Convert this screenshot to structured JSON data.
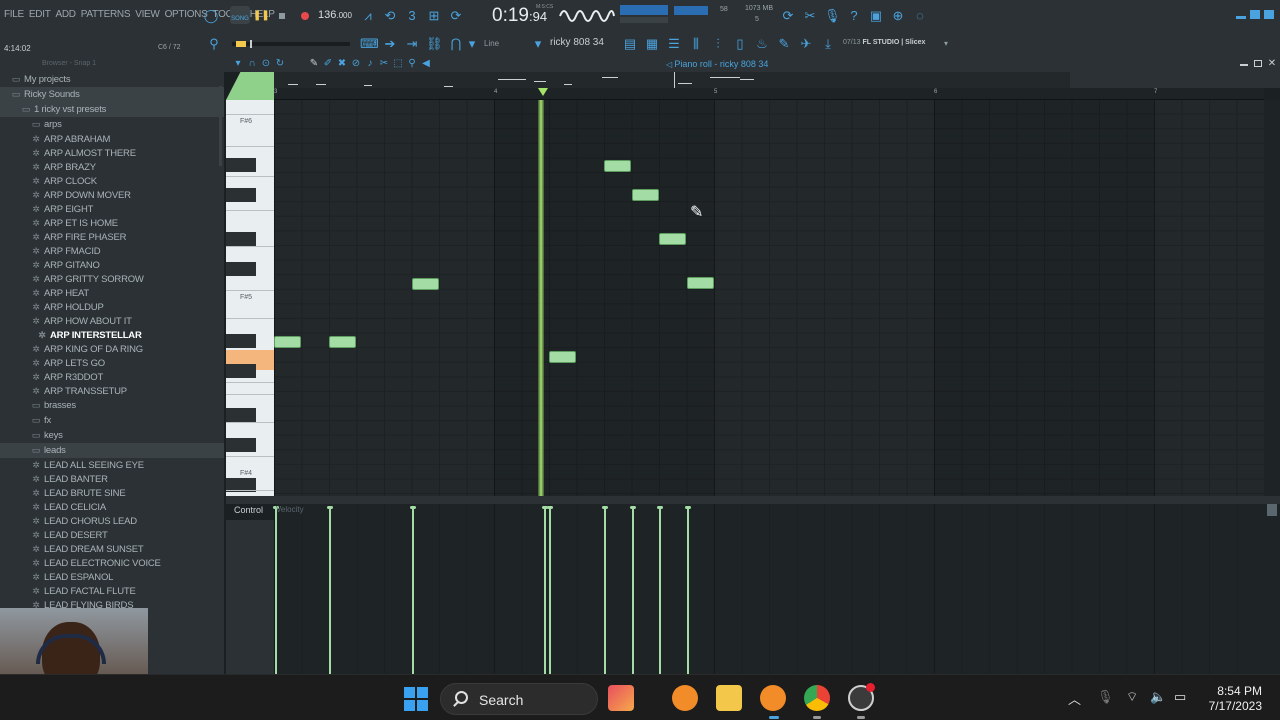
{
  "menu": [
    "FILE",
    "EDIT",
    "ADD",
    "PATTERNS",
    "VIEW",
    "OPTIONS",
    "TOOLS",
    "HELP"
  ],
  "transport": {
    "mode": "SONG",
    "tempo": "136",
    "tempo_decimal": ".000",
    "time_main": "0:19",
    "time_frac": ":94",
    "time_unit": "M:S:CS",
    "cpu_value": "58",
    "memory": "1073 MB",
    "polyphony": "5"
  },
  "toolbar2": {
    "song_position": "4:14:02",
    "channel_pos": "C6 / 72",
    "snap": "Line",
    "pattern": "ricky 808 34",
    "hint_counter": "07/13",
    "hint_text": "FL STUDIO | Slicex"
  },
  "browser": {
    "header": "Browser - Snap 1",
    "tree": [
      {
        "label": "My projects",
        "icon": "folder",
        "indent": 10
      },
      {
        "label": "Ricky Sounds",
        "icon": "folder",
        "indent": 10
      },
      {
        "label": "1 ricky vst presets",
        "icon": "folder",
        "indent": 20
      },
      {
        "label": "arps",
        "icon": "folder",
        "indent": 30
      },
      {
        "label": "ARP ABRAHAM",
        "icon": "preset",
        "indent": 30
      },
      {
        "label": "ARP ALMOST THERE",
        "icon": "preset",
        "indent": 30
      },
      {
        "label": "ARP BRAZY",
        "icon": "preset",
        "indent": 30
      },
      {
        "label": "ARP CLOCK",
        "icon": "preset",
        "indent": 30
      },
      {
        "label": "ARP DOWN MOVER",
        "icon": "preset",
        "indent": 30
      },
      {
        "label": "ARP EIGHT",
        "icon": "preset",
        "indent": 30
      },
      {
        "label": "ARP ET IS HOME",
        "icon": "preset",
        "indent": 30
      },
      {
        "label": "ARP FIRE PHASER",
        "icon": "preset",
        "indent": 30
      },
      {
        "label": "ARP FMACID",
        "icon": "preset",
        "indent": 30
      },
      {
        "label": "ARP GITANO",
        "icon": "preset",
        "indent": 30
      },
      {
        "label": "ARP GRITTY SORROW",
        "icon": "preset",
        "indent": 30
      },
      {
        "label": "ARP HEAT",
        "icon": "preset",
        "indent": 30
      },
      {
        "label": "ARP HOLDUP",
        "icon": "preset",
        "indent": 30
      },
      {
        "label": "ARP HOW ABOUT IT",
        "icon": "preset",
        "indent": 30
      },
      {
        "label": "ARP INTERSTELLAR",
        "icon": "preset",
        "indent": 36
      },
      {
        "label": "ARP KING OF DA RING",
        "icon": "preset",
        "indent": 30
      },
      {
        "label": "ARP LETS GO",
        "icon": "preset",
        "indent": 30
      },
      {
        "label": "ARP R3DDOT",
        "icon": "preset",
        "indent": 30
      },
      {
        "label": "ARP TRANSSETUP",
        "icon": "preset",
        "indent": 30
      },
      {
        "label": "brasses",
        "icon": "folder",
        "indent": 30
      },
      {
        "label": "fx",
        "icon": "folder",
        "indent": 30
      },
      {
        "label": "keys",
        "icon": "folder",
        "indent": 30
      },
      {
        "label": "leads",
        "icon": "folder",
        "indent": 30
      },
      {
        "label": "LEAD ALL SEEING EYE",
        "icon": "preset",
        "indent": 30
      },
      {
        "label": "LEAD BANTER",
        "icon": "preset",
        "indent": 30
      },
      {
        "label": "LEAD BRUTE SINE",
        "icon": "preset",
        "indent": 30
      },
      {
        "label": "LEAD CELICIA",
        "icon": "preset",
        "indent": 30
      },
      {
        "label": "LEAD CHORUS LEAD",
        "icon": "preset",
        "indent": 30
      },
      {
        "label": "LEAD DESERT",
        "icon": "preset",
        "indent": 30
      },
      {
        "label": "LEAD DREAM SUNSET",
        "icon": "preset",
        "indent": 30
      },
      {
        "label": "LEAD ELECTRONIC VOICE",
        "icon": "preset",
        "indent": 30
      },
      {
        "label": "LEAD ESPANOL",
        "icon": "preset",
        "indent": 30
      },
      {
        "label": "LEAD FACTAL FLUTE",
        "icon": "preset",
        "indent": 30
      },
      {
        "label": "LEAD FLYING BIRDS",
        "icon": "preset",
        "indent": 30
      }
    ]
  },
  "piano_roll": {
    "title": "Piano roll - ricky 808 34",
    "ruler_numbers": [
      "3",
      "4",
      "5",
      "6",
      "7"
    ],
    "key_labels": [
      "F#6",
      "F#5",
      "F#4"
    ],
    "control_label": "Control",
    "control_target": "Velocity"
  },
  "taskbar": {
    "search_placeholder": "Search",
    "time": "8:54 PM",
    "date": "7/17/2023"
  },
  "colors": {
    "note_fill": "#a3dca4",
    "playhead": "#a4e26a",
    "accent_blue": "#4aa3df",
    "active_key": "#f4b67c"
  }
}
